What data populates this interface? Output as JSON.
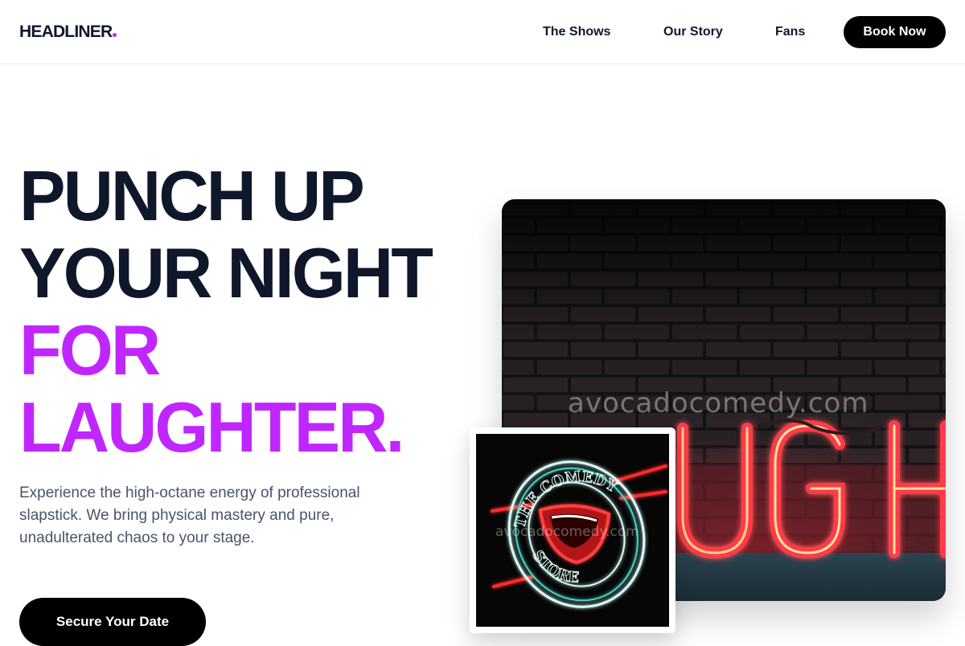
{
  "brand": {
    "name": "HEADLINER",
    "accent_color": "#c026ff",
    "dark_color": "#0f172a"
  },
  "nav": {
    "links": [
      {
        "label": "The Shows"
      },
      {
        "label": "Our Story"
      },
      {
        "label": "Fans"
      }
    ],
    "book_label": "Book Now"
  },
  "hero": {
    "headline_lines": [
      "PUNCH UP",
      "YOUR NIGHT",
      "FOR",
      "LAUGHTER."
    ],
    "description": "Experience the high-octane energy of professional slapstick. We bring physical mastery and pure, unadulterated chaos to your stage.",
    "cta_label": "Secure Your Date"
  },
  "images": {
    "main": {
      "watermark": "avocadocomedy.com",
      "neon_text": "UGH",
      "icon": "neon-laugh-sign-photo"
    },
    "inset": {
      "watermark": "avocadocomedy.com",
      "sign_top": "THE COMEDY",
      "sign_bottom": "STORE",
      "icon": "comedy-store-neon-sign-photo"
    }
  }
}
